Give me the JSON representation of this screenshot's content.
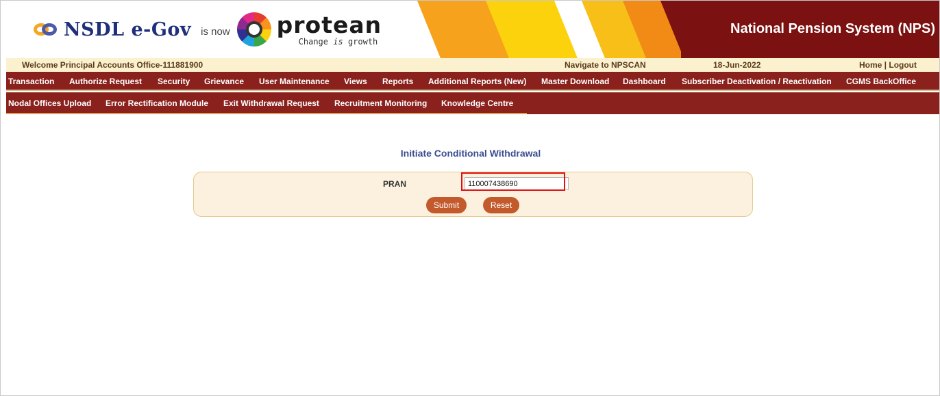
{
  "header": {
    "nsdl_brand": "NSDL e-Gov",
    "is_now": "is now",
    "protean_brand": "protean",
    "protean_tagline_pre": "Change",
    "protean_tagline_is": "is",
    "protean_tagline_post": "growth",
    "system_title": "National Pension System (NPS)"
  },
  "welcome_bar": {
    "welcome_text": "Welcome Principal Accounts Office-111881900",
    "navigate_link": "Navigate to NPSCAN",
    "date": "18-Jun-2022",
    "home_logout": "Home | Logout"
  },
  "nav_primary": [
    "Transaction",
    "Authorize Request",
    "Security",
    "Grievance",
    "User Maintenance",
    "Views",
    "Reports",
    "Additional Reports (New)",
    "Master Download",
    "Dashboard",
    "Subscriber Deactivation / Reactivation",
    "CGMS BackOffice"
  ],
  "nav_secondary": [
    "Nodal Offices Upload",
    "Error Rectification Module",
    "Exit Withdrawal Request",
    "Recruitment Monitoring",
    "Knowledge Centre"
  ],
  "form": {
    "title": "Initiate Conditional Withdrawal",
    "pran_label": "PRAN",
    "pran_value": "110007438690",
    "submit_label": "Submit",
    "reset_label": "Reset"
  },
  "colors": {
    "nav_bg": "#8a211c",
    "header_right_bg": "#7b1110",
    "welcome_bg": "#fbf1cf",
    "button_bg": "#c35a2c",
    "title_color": "#3a4d8f",
    "highlight": "#e01010"
  },
  "icons": {
    "nsdl_logo": "nsdl-rings-logo",
    "protean_logo": "protean-circle-logo"
  }
}
